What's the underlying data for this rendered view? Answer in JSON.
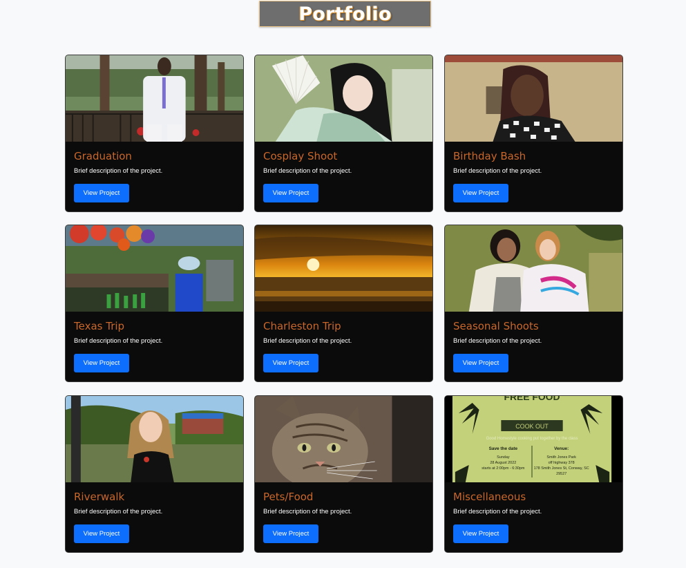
{
  "page": {
    "title": "Portfolio"
  },
  "projects": [
    {
      "title": "Graduation",
      "description": "Brief description of the project.",
      "button": "View Project"
    },
    {
      "title": "Cosplay Shoot",
      "description": "Brief description of the project.",
      "button": "View Project"
    },
    {
      "title": "Birthday Bash",
      "description": "Brief description of the project.",
      "button": "View Project"
    },
    {
      "title": "Texas Trip",
      "description": "Brief description of the project.",
      "button": "View Project"
    },
    {
      "title": "Charleston Trip",
      "description": "Brief description of the project.",
      "button": "View Project"
    },
    {
      "title": "Seasonal Shoots",
      "description": "Brief description of the project.",
      "button": "View Project"
    },
    {
      "title": "Riverwalk",
      "description": "Brief description of the project.",
      "button": "View Project"
    },
    {
      "title": "Pets/Food",
      "description": "Brief description of the project.",
      "button": "View Project"
    },
    {
      "title": "Miscellaneous",
      "description": "Brief description of the project.",
      "button": "View Project"
    }
  ],
  "flyer": {
    "heading": "FREE FOOD",
    "badge": "COOK OUT",
    "tagline": "Good Homestyle cooking put together by the class",
    "save_label": "Save the date",
    "day": "Sunday",
    "date": "28 August 2022",
    "time": "starts at 2:00pm - 6:30pm",
    "venue_label": "Venue:",
    "venue_name": "Smith Jones Park",
    "venue_note": "off highway 378",
    "venue_address": "178 Smith Jones St, Conway, SC",
    "venue_zip": "29527"
  },
  "colors": {
    "accent": "#0d6efd",
    "card_title": "#c9672b",
    "card_bg": "#0b0b0c",
    "page_bg": "#f7f9fb"
  }
}
